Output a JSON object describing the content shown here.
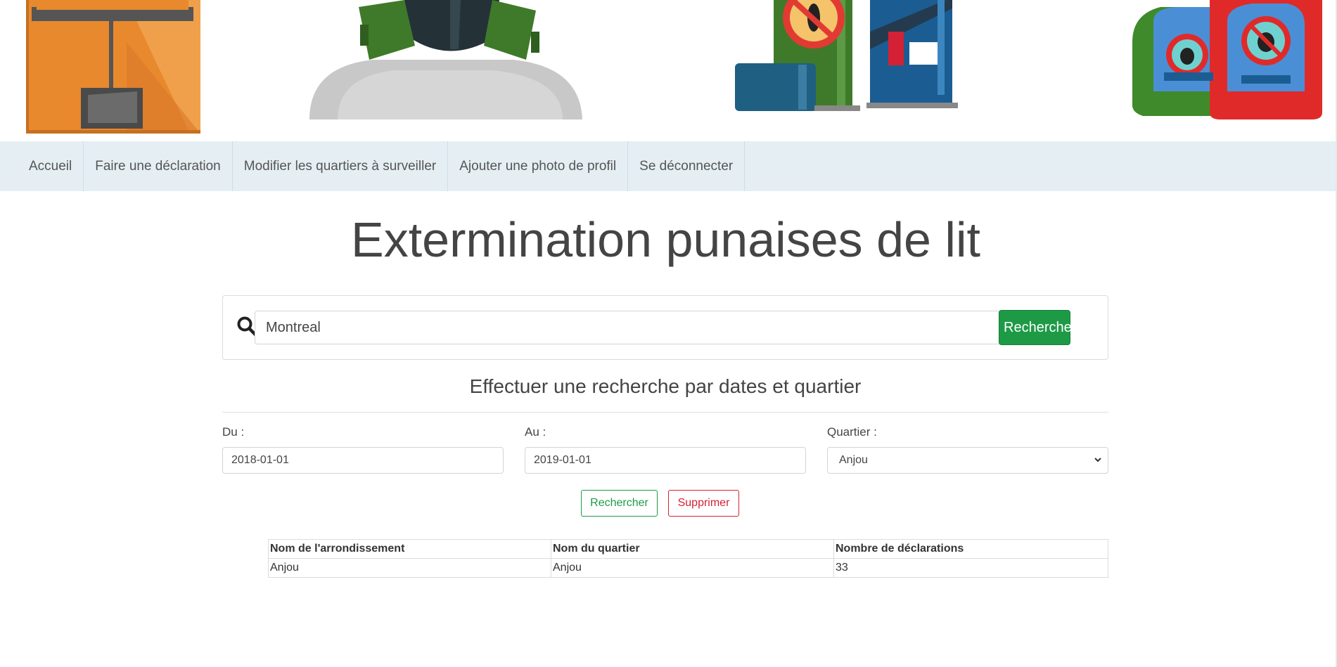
{
  "nav": {
    "items": [
      "Accueil",
      "Faire une déclaration",
      "Modifier les quartiers à surveiller",
      "Ajouter une photo de profil",
      "Se déconnecter"
    ]
  },
  "page_title": "Extermination punaises de lit",
  "search": {
    "value": "Montreal",
    "button_label": "Rechercher"
  },
  "filter": {
    "title": "Effectuer une recherche par dates et quartier",
    "from_label": "Du :",
    "from_value": "2018-01-01",
    "to_label": "Au :",
    "to_value": "2019-01-01",
    "quartier_label": "Quartier :",
    "quartier_value": "Anjou",
    "search_button": "Rechercher",
    "delete_button": "Supprimer"
  },
  "results": {
    "headers": [
      "Nom de l'arrondissement",
      "Nom du quartier",
      "Nombre de déclarations"
    ],
    "rows": [
      [
        "Anjou",
        "Anjou",
        "33"
      ]
    ]
  },
  "colors": {
    "nav_bg": "#e5eff3",
    "primary_green": "#1e9a47",
    "danger_red": "#d42135"
  }
}
